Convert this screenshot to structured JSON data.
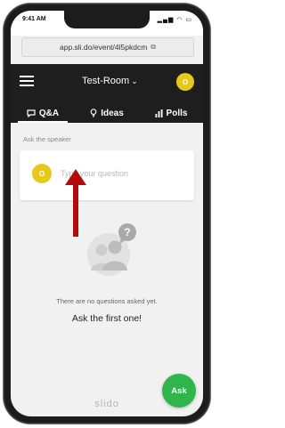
{
  "status_bar": {
    "time": "9:41 AM",
    "icons": "signal-wifi-battery"
  },
  "browser": {
    "url": "app.sli.do/event/4l5pkdcm",
    "copy_icon": "copy-icon"
  },
  "header": {
    "room_name": "Test-Room",
    "avatar_initial": "O",
    "menu_icon": "hamburger-icon"
  },
  "tabs": [
    {
      "label": "Q&A",
      "icon": "speech-bubble-icon",
      "active": true
    },
    {
      "label": "Ideas",
      "icon": "lightbulb-icon",
      "active": false
    },
    {
      "label": "Polls",
      "icon": "bar-chart-icon",
      "active": false
    }
  ],
  "question_section": {
    "label": "Ask the speaker",
    "avatar_initial": "O",
    "placeholder": "Type your question"
  },
  "empty_state": {
    "message": "There are no questions asked yet.",
    "call_to_action": "Ask the first one!"
  },
  "footer": {
    "brand": "slido",
    "ask_button": "Ask"
  },
  "colors": {
    "header_bg": "#1e1e1e",
    "accent_yellow": "#e8c81b",
    "ask_green": "#2fb54a",
    "arrow_red": "#b30b0b"
  }
}
